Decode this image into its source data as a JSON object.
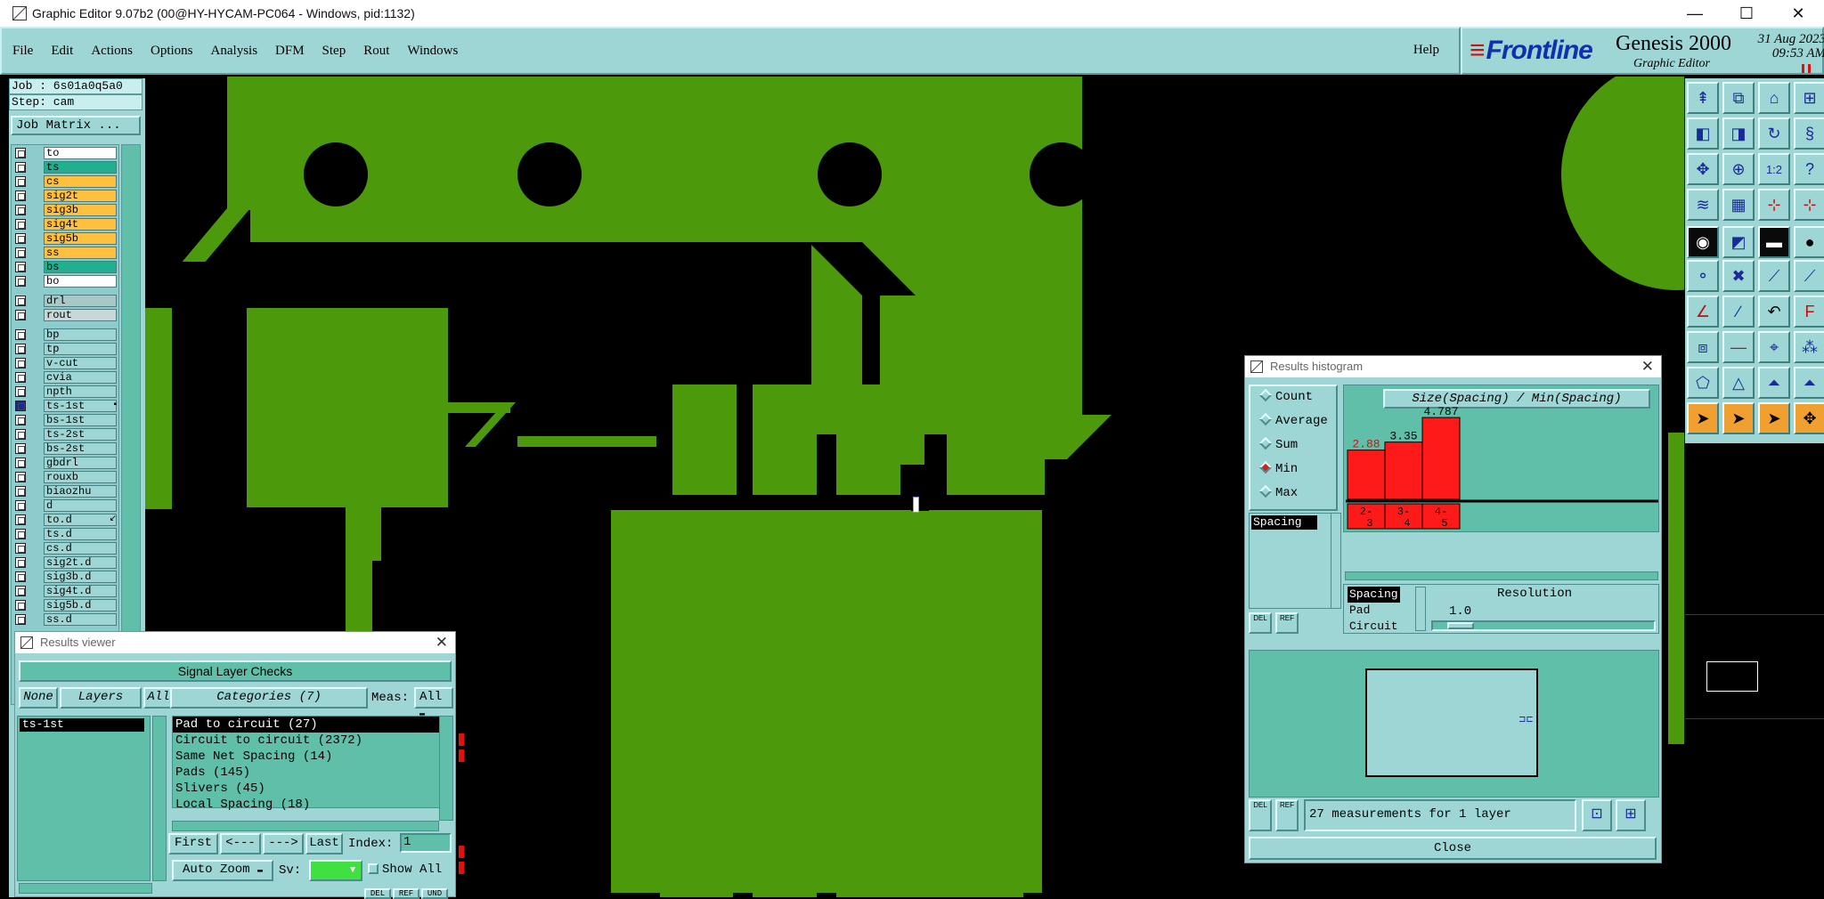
{
  "window": {
    "title": "Graphic Editor 9.07b2 (00@HY-HYCAM-PC064 - Windows, pid:1132)"
  },
  "menu": {
    "items": [
      "File",
      "Edit",
      "Actions",
      "Options",
      "Analysis",
      "DFM",
      "Step",
      "Rout",
      "Windows"
    ],
    "help": "Help"
  },
  "brand": {
    "logo": "Frontline",
    "product": "Genesis 2000",
    "subtitle": "Graphic Editor",
    "date": "31 Aug 2023",
    "time": "09:53 AM"
  },
  "left_panel": {
    "job": "Job : 6s01a0q5a0",
    "step": "Step: cam",
    "job_matrix": "Job Matrix ..."
  },
  "layers": [
    {
      "name": "to",
      "color": "#ffffff"
    },
    {
      "name": "ts",
      "color": "#20b090"
    },
    {
      "name": "cs",
      "color": "#ffc040"
    },
    {
      "name": "sig2t",
      "color": "#ffc040"
    },
    {
      "name": "sig3b",
      "color": "#ffc040"
    },
    {
      "name": "sig4t",
      "color": "#ffc040"
    },
    {
      "name": "sig5b",
      "color": "#ffc040"
    },
    {
      "name": "ss",
      "color": "#ffc040"
    },
    {
      "name": "bs",
      "color": "#20b090"
    },
    {
      "name": "bo",
      "color": "#ffffff"
    },
    {
      "name": "drl",
      "color": "#a8c8c8"
    },
    {
      "name": "rout",
      "color": "#c8d8d8"
    },
    {
      "name": "bp",
      "color": "#9ed6d6"
    },
    {
      "name": "tp",
      "color": "#9ed6d6"
    },
    {
      "name": "v-cut",
      "color": "#9ed6d6"
    },
    {
      "name": "cvia",
      "color": "#9ed6d6"
    },
    {
      "name": "npth",
      "color": "#9ed6d6"
    },
    {
      "name": "ts-1st",
      "color": "#9ed6d6",
      "mark": "▪"
    },
    {
      "name": "bs-1st",
      "color": "#9ed6d6"
    },
    {
      "name": "ts-2st",
      "color": "#9ed6d6"
    },
    {
      "name": "bs-2st",
      "color": "#9ed6d6"
    },
    {
      "name": "gbdrl",
      "color": "#9ed6d6"
    },
    {
      "name": "rouxb",
      "color": "#9ed6d6"
    },
    {
      "name": "biaozhu",
      "color": "#9ed6d6"
    },
    {
      "name": "d",
      "color": "#9ed6d6"
    },
    {
      "name": "to.d",
      "color": "#9ed6d6",
      "mark": "↙"
    },
    {
      "name": "ts.d",
      "color": "#9ed6d6"
    },
    {
      "name": "cs.d",
      "color": "#9ed6d6"
    },
    {
      "name": "sig2t.d",
      "color": "#9ed6d6"
    },
    {
      "name": "sig3b.d",
      "color": "#9ed6d6"
    },
    {
      "name": "sig4t.d",
      "color": "#9ed6d6"
    },
    {
      "name": "sig5b.d",
      "color": "#9ed6d6"
    },
    {
      "name": "ss.d",
      "color": "#9ed6d6"
    }
  ],
  "results_viewer": {
    "title": "Results viewer",
    "header": "Signal Layer Checks",
    "none": "None",
    "layers": "Layers",
    "all": "All",
    "categories_label": "Categories (7)",
    "meas_label": "Meas:",
    "meas_value": "All",
    "layer_selected": "ts-1st",
    "categories": [
      "Pad to circuit (27)",
      "Circuit to circuit (2372)",
      "Same Net Spacing (14)",
      "Pads (145)",
      "Slivers (45)",
      "Local Spacing (18)"
    ],
    "first": "First",
    "prev": "<---",
    "next": "--->",
    "last": "Last",
    "index_label": "Index:",
    "index_value": "1",
    "auto_zoom": "Auto Zoom",
    "sv_label": "Sv:",
    "show_all": "Show All",
    "foot_del": "DEL",
    "foot_ref": "REF",
    "foot_und": "UND"
  },
  "histogram": {
    "title": "Results histogram",
    "modes": [
      "Count",
      "Average",
      "Sum",
      "Min",
      "Max"
    ],
    "active_mode": "Min",
    "measure_tab": "Spacing",
    "chart_title": "Size(Spacing) / Min(Spacing)",
    "list_items": [
      "Spacing",
      "Pad",
      "Circuit"
    ],
    "resolution_label": "Resolution",
    "resolution_value": "1.0",
    "status": "27 measurements for 1 layer",
    "close": "Close",
    "del": "DEL",
    "ref": "REF"
  },
  "chart_data": {
    "type": "bar",
    "title": "Size(Spacing) / Min(Spacing)",
    "categories": [
      "2-3",
      "3-4",
      "4-5"
    ],
    "values": [
      2.88,
      3.35,
      4.787
    ],
    "value_labels": [
      "2.88",
      "3.35",
      "4.787"
    ],
    "bar_color": "#ff1a1a",
    "highlight_label_color": "#d01010"
  }
}
